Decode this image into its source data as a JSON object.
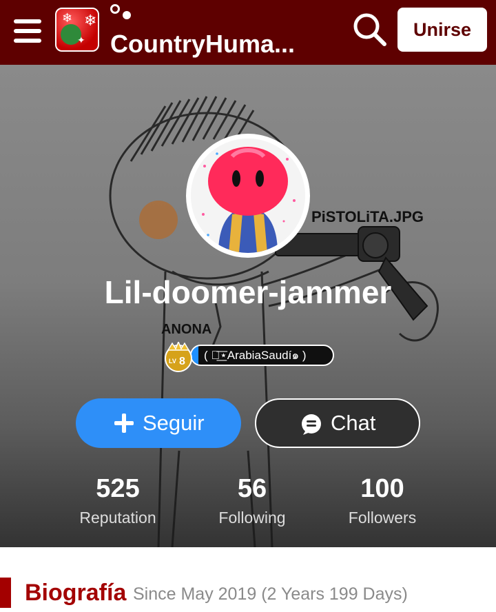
{
  "topbar": {
    "community_name": "CountryHuma...",
    "join_label": "Unirse",
    "icons": [
      "menu-icon",
      "community-icon",
      "amino-logo-icon",
      "search-icon"
    ],
    "background_color": "#5e0000"
  },
  "profile": {
    "username": "Lil-doomer-jammer",
    "level": "8",
    "level_prefix": "LV",
    "title": "( ༺͟͞⋆ArabiaSaudí๑ )",
    "follow_label": "Seguir",
    "chat_label": "Chat",
    "stats": [
      {
        "value": "525",
        "label": "Reputation"
      },
      {
        "value": "56",
        "label": "Following"
      },
      {
        "value": "100",
        "label": "Followers"
      }
    ],
    "colors": {
      "follow_button": "#2e8ff8",
      "chat_button": "#2f2f2f",
      "title_accent": "#1e90ff"
    }
  },
  "bio": {
    "title": "Biografía",
    "since": "Since May 2019 (2 Years 199 Days)",
    "accent_color": "#a30000"
  }
}
